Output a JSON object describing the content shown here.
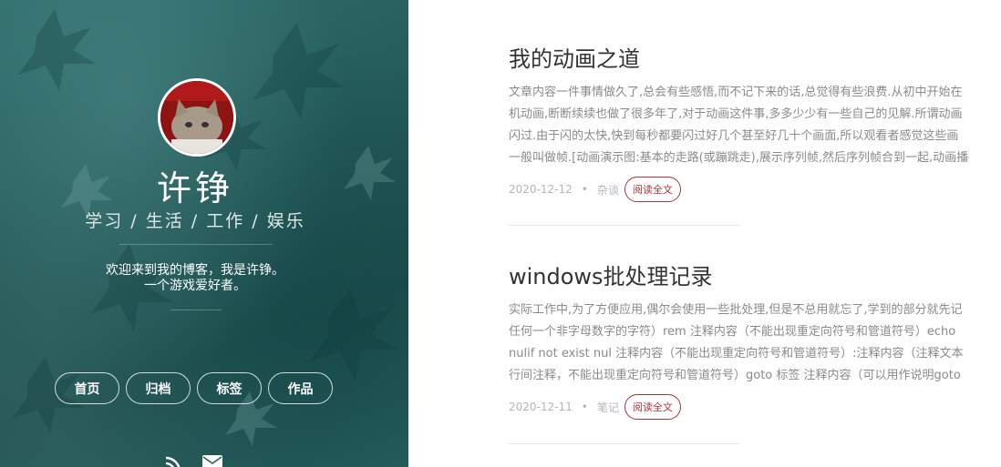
{
  "sidebar": {
    "name": "许铮",
    "tagline": "学习 / 生活 / 工作 / 娱乐",
    "intro_line1": "欢迎来到我的博客，我是许铮。",
    "intro_line2": "一个游戏爱好者。",
    "nav": [
      {
        "label": "首页"
      },
      {
        "label": "归档"
      },
      {
        "label": "标签"
      },
      {
        "label": "作品"
      }
    ],
    "social_icons": [
      "rss-icon",
      "mail-icon"
    ]
  },
  "posts": [
    {
      "title": "我的动画之道",
      "excerpt": [
        "文章内容一件事情做久了,总会有些感悟,而不记下来的话,总觉得有些浪费.从初中开始在",
        "机动画,断断续续也做了很多年了,对于动画这件事,多多少少有一些自己的见解.所谓动画",
        "闪过.由于闪的太快,快到每秒都要闪过好几个甚至好几十个画面,所以观看者感觉这些画",
        "一般叫做帧.[动画演示图:基本的走路(或蹦跳走),展示序列帧,然后序列帧合到一起,动画播"
      ],
      "date": "2020-12-12",
      "category": "杂谈",
      "read_more": "阅读全文"
    },
    {
      "title": "windows批处理记录",
      "excerpt": [
        "实际工作中,为了方便应用,偶尔会使用一些批处理,但是不总用就忘了,学到的部分就先记",
        "任何一个非字母数字的字符）rem 注释内容（不能出现重定向符号和管道符号）echo",
        "nulif not exist nul 注释内容（不能出现重定向符号和管道符号）:注释内容（注释文本",
        "行间注释，不能出现重定向符号和管道符号）goto 标签 注释内容（可以用作说明goto"
      ],
      "date": "2020-12-11",
      "category": "笔记",
      "read_more": "阅读全文"
    }
  ],
  "colors": {
    "sidebar_bg": "#245a5a",
    "accent": "#a8353a",
    "title": "#333333",
    "excerpt": "#8a8a8a"
  }
}
